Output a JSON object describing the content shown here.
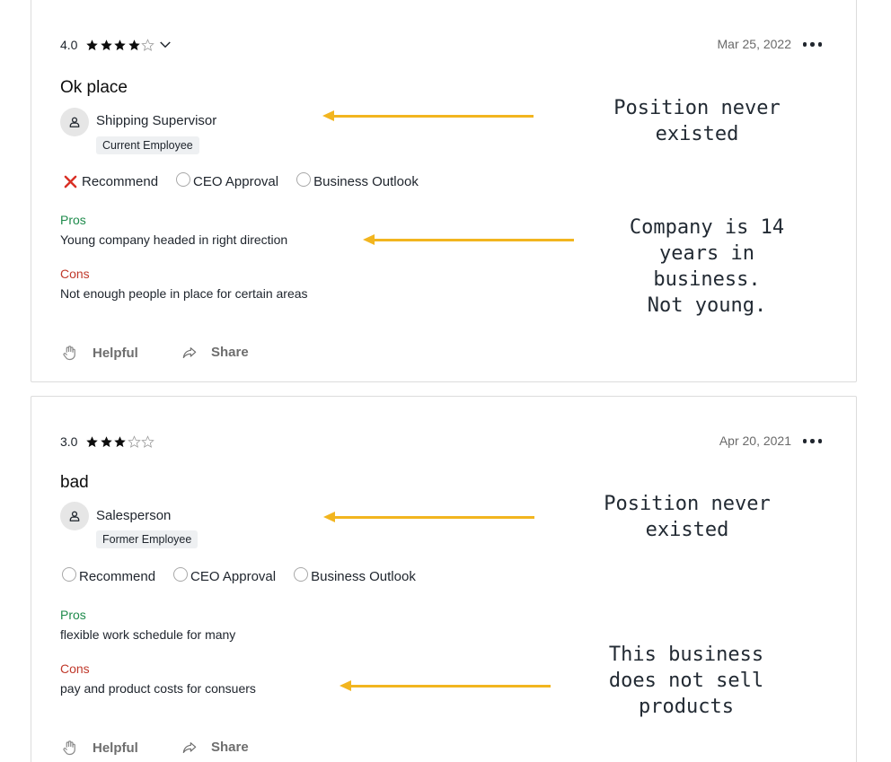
{
  "reviews": [
    {
      "rating": "4.0",
      "stars_filled": 4,
      "date": "Mar 25, 2022",
      "title": "Ok place",
      "job_title": "Shipping Supervisor",
      "status": "Current Employee",
      "recommend_label": "Recommend",
      "ceo_label": "CEO Approval",
      "outlook_label": "Business Outlook",
      "recommend_state": "negative",
      "pros_label": "Pros",
      "pros": "Young company headed in right direction",
      "cons_label": "Cons",
      "cons": "Not enough people in place for certain areas",
      "helpful_label": "Helpful",
      "share_label": "Share"
    },
    {
      "rating": "3.0",
      "stars_filled": 3,
      "date": "Apr 20, 2021",
      "title": "bad",
      "job_title": "Salesperson",
      "status": "Former Employee",
      "recommend_label": "Recommend",
      "ceo_label": "CEO Approval",
      "outlook_label": "Business Outlook",
      "recommend_state": "none",
      "pros_label": "Pros",
      "pros": "flexible work schedule for many",
      "cons_label": "Cons",
      "cons": "pay and product costs for consuers",
      "helpful_label": "Helpful",
      "share_label": "Share"
    }
  ],
  "annotations": [
    {
      "text": "Position never\nexisted"
    },
    {
      "text": "Company is 14\nyears in business.\nNot young."
    },
    {
      "text": "Position never\nexisted"
    },
    {
      "text": "This business\ndoes not sell\nproducts"
    }
  ],
  "colors": {
    "arrow": "#f2b51f",
    "pros": "#1f8b4c",
    "cons": "#c0392b",
    "negative_x": "#d93025"
  }
}
